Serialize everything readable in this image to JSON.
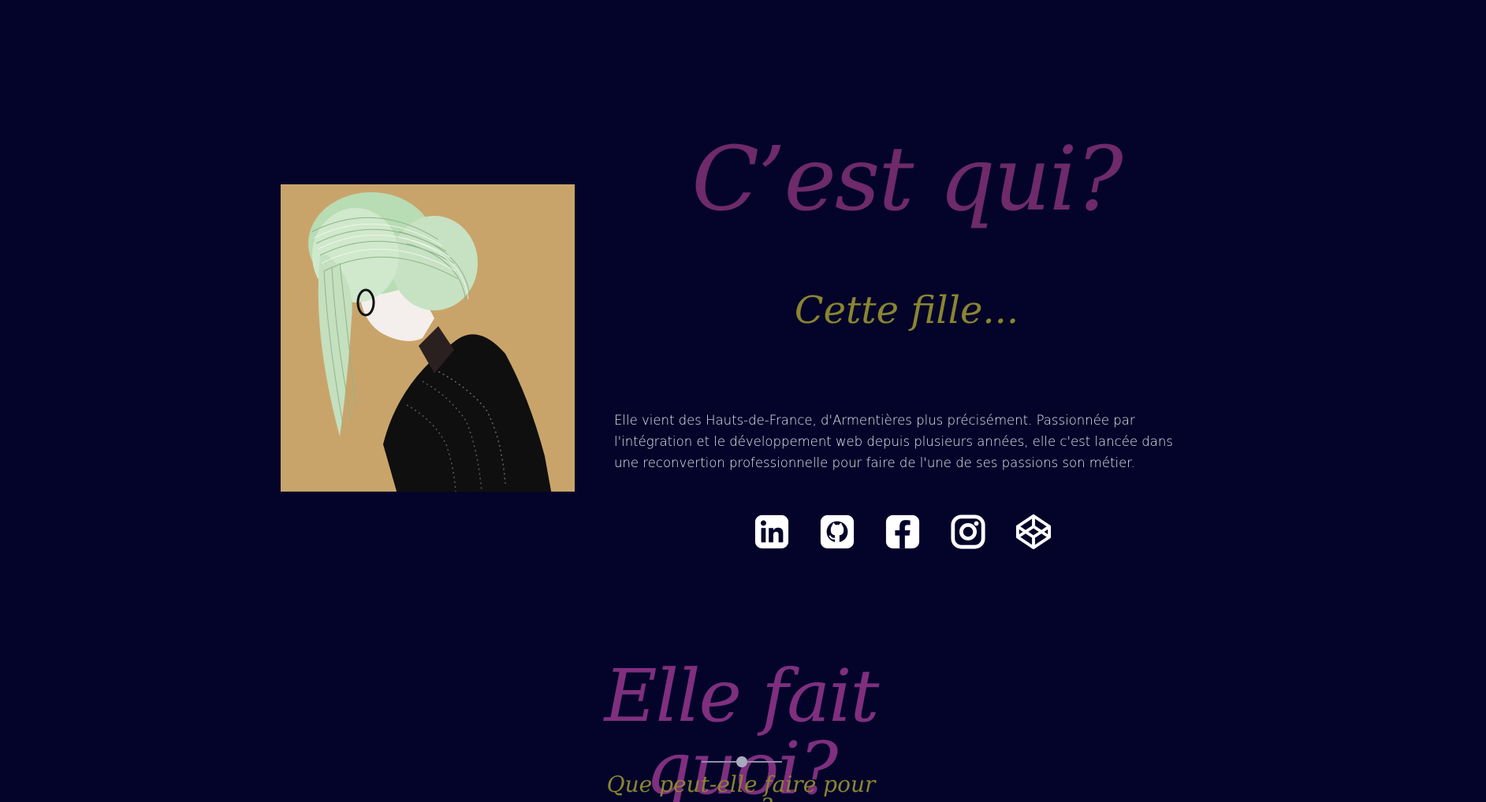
{
  "about": {
    "title": "C’est qui?",
    "subtitle": "Cette fille...",
    "bio": "Elle vient des Hauts-de-France, d'Armentières plus précisément. Passionnée par l'intégration et le développement web depuis plusieurs années, elle c'est lancée dans une reconvertion professionnelle pour faire de l'une de ses passions son métier.",
    "portrait_icon": "illustrated-portrait-woman-green-hair"
  },
  "socials": [
    {
      "name": "LinkedIn",
      "icon": "linkedin-icon"
    },
    {
      "name": "GitHub",
      "icon": "github-icon"
    },
    {
      "name": "Facebook",
      "icon": "facebook-icon"
    },
    {
      "name": "Instagram",
      "icon": "instagram-icon"
    },
    {
      "name": "CodePen",
      "icon": "codepen-icon"
    }
  ],
  "services": {
    "title": "Elle fait quoi?",
    "subtitle": "Que peut-elle faire pour vous?"
  },
  "colors": {
    "background": "#04042a",
    "title_purple": "#6e2a6a",
    "subtitle_olive": "#8a8530",
    "text": "#e8e6f2",
    "portrait_bg": "#c9a46a"
  }
}
